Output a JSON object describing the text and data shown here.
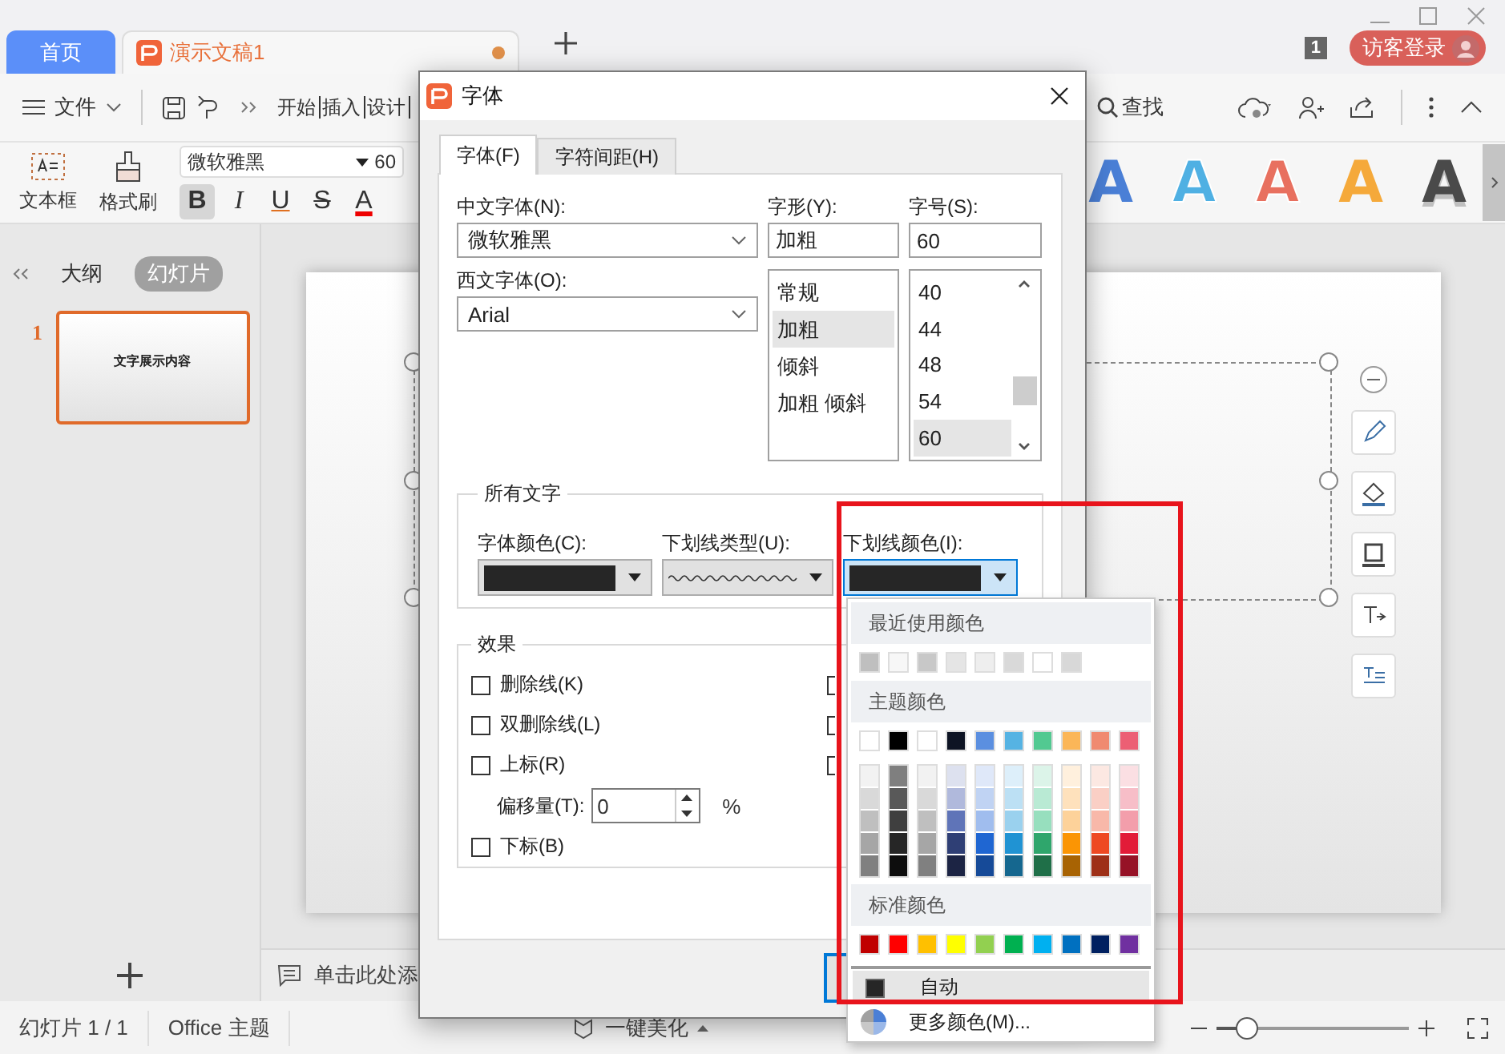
{
  "tabs": [
    {
      "kind": "home",
      "label": "首页"
    },
    {
      "kind": "document",
      "label": "演示文稿1",
      "unsaved": true
    }
  ],
  "window_count": "1",
  "login_button": "访客登录",
  "menu": {
    "file": "文件",
    "items": [
      "开始",
      "插入",
      "设计"
    ],
    "search": "查找"
  },
  "ribbon": {
    "textbox": "文本框",
    "format_painter": "格式刷",
    "font_name": "微软雅黑",
    "font_size": "60",
    "styles": [
      {
        "kind": "bold",
        "label": "B",
        "selected": true
      },
      {
        "kind": "italic",
        "label": "I",
        "selected": false
      },
      {
        "kind": "underline",
        "label": "U",
        "selected": false
      },
      {
        "kind": "strike",
        "label": "S",
        "selected": false
      },
      {
        "kind": "color",
        "label": "A",
        "selected": false
      }
    ],
    "wordart": [
      {
        "kind": "fill",
        "label": "A",
        "color": "#4a7fd6"
      },
      {
        "kind": "outline",
        "label": "A",
        "color": "#4fb0e3"
      },
      {
        "kind": "outline",
        "label": "A",
        "color": "#e8705f"
      },
      {
        "kind": "fill",
        "label": "A",
        "color": "#f5a93a"
      },
      {
        "kind": "gradient",
        "label": "A",
        "color": "#4a4a4a"
      }
    ]
  },
  "side_panel": {
    "tabs": [
      {
        "label": "大纲",
        "selected": false
      },
      {
        "label": "幻灯片",
        "selected": true
      }
    ],
    "slides": [
      {
        "number": "1",
        "title": "文字展示内容",
        "selected": true
      }
    ]
  },
  "notes_placeholder": "单击此处添",
  "status_bar": {
    "slide_count": "幻灯片 1 / 1",
    "theme": "Office 主题",
    "beautify": "一键美化",
    "zoom": {
      "level": 0.15
    }
  },
  "dialog": {
    "title": "字体",
    "tabs": [
      {
        "label": "字体(F)",
        "selected": true
      },
      {
        "label": "字符间距(H)",
        "selected": false
      }
    ],
    "chinese_font": {
      "label": "中文字体(N):",
      "value": "微软雅黑"
    },
    "western_font": {
      "label": "西文字体(O):",
      "value": "Arial"
    },
    "font_style": {
      "label": "字形(Y):",
      "value": "加粗",
      "options": [
        {
          "label": "常规",
          "selected": false
        },
        {
          "label": "加粗",
          "selected": true
        },
        {
          "label": "倾斜",
          "selected": false
        },
        {
          "label": "加粗 倾斜",
          "selected": false
        }
      ]
    },
    "font_size": {
      "label": "字号(S):",
      "value": "60",
      "options": [
        {
          "label": "40",
          "selected": false
        },
        {
          "label": "44",
          "selected": false
        },
        {
          "label": "48",
          "selected": false
        },
        {
          "label": "54",
          "selected": false
        },
        {
          "label": "60",
          "selected": true
        }
      ]
    },
    "all_text": {
      "title": "所有文字",
      "font_color": {
        "label": "字体颜色(C):",
        "color": "#262626",
        "focused": false
      },
      "underline_type": {
        "label": "下划线类型(U):",
        "kind": "wavy"
      },
      "underline_color": {
        "label": "下划线颜色(I):",
        "color": "#262626",
        "focused": true
      }
    },
    "effects": {
      "title": "效果",
      "options": [
        {
          "label": "删除线(K)",
          "checked": false
        },
        {
          "label": "双删除线(L)",
          "checked": false
        },
        {
          "label": "上标(R)",
          "checked": false
        },
        {
          "label": "下标(B)",
          "checked": false
        }
      ],
      "hidden_options": [
        {
          "checked": false
        },
        {
          "checked": false
        },
        {
          "checked": false
        }
      ],
      "offset": {
        "label": "偏移量(T):",
        "value": "0",
        "unit": "%"
      }
    }
  },
  "color_menu": {
    "recent_title": "最近使用颜色",
    "recent": [
      {
        "color": "#bfbfbf"
      },
      {
        "color": "#f7f7f7"
      },
      {
        "color": "#c8c8c8"
      },
      {
        "color": "#e5e5e5"
      },
      {
        "color": "#eeeeee"
      },
      {
        "color": "#d9d9d9"
      },
      {
        "color": "#ffffff"
      },
      {
        "color": "#d8d8d8"
      }
    ],
    "theme_title": "主题颜色",
    "theme": [
      {
        "color": "#ffffff"
      },
      {
        "color": "#000000"
      },
      {
        "color": "#ffffff"
      },
      {
        "color": "#0e1424"
      },
      {
        "color": "#5b8fe0"
      },
      {
        "color": "#56b3e3"
      },
      {
        "color": "#52c991"
      },
      {
        "color": "#fbb658"
      },
      {
        "color": "#f08a70"
      },
      {
        "color": "#ec5f74"
      }
    ],
    "shades": [
      [
        {
          "color": "#f2f2f2"
        },
        {
          "color": "#d9d9d9"
        },
        {
          "color": "#bfbfbf"
        },
        {
          "color": "#a6a6a6"
        },
        {
          "color": "#808080"
        }
      ],
      [
        {
          "color": "#7f7f7f"
        },
        {
          "color": "#595959"
        },
        {
          "color": "#3f3f3f"
        },
        {
          "color": "#262626"
        },
        {
          "color": "#0d0d0d"
        }
      ],
      [
        {
          "color": "#f2f2f2"
        },
        {
          "color": "#d9d9d9"
        },
        {
          "color": "#bfbfbf"
        },
        {
          "color": "#a6a6a6"
        },
        {
          "color": "#808080"
        }
      ],
      [
        {
          "color": "#dde1ef"
        },
        {
          "color": "#b0b9dc"
        },
        {
          "color": "#5f74b8"
        },
        {
          "color": "#2f3f75"
        },
        {
          "color": "#1c2444"
        }
      ],
      [
        {
          "color": "#dfe8f9"
        },
        {
          "color": "#c0d3f3"
        },
        {
          "color": "#a0bdee"
        },
        {
          "color": "#1f66d2"
        },
        {
          "color": "#164a98"
        }
      ],
      [
        {
          "color": "#ddeffa"
        },
        {
          "color": "#bce0f4"
        },
        {
          "color": "#9ad1ee"
        },
        {
          "color": "#2093d3"
        },
        {
          "color": "#15678f"
        }
      ],
      [
        {
          "color": "#dcf4e9"
        },
        {
          "color": "#b9ead4"
        },
        {
          "color": "#97dfbe"
        },
        {
          "color": "#2fa66c"
        },
        {
          "color": "#1f6f48"
        }
      ],
      [
        {
          "color": "#fff0dd"
        },
        {
          "color": "#fee1bc"
        },
        {
          "color": "#fdd29a"
        },
        {
          "color": "#fb9504"
        },
        {
          "color": "#a86303"
        }
      ],
      [
        {
          "color": "#fce8e2"
        },
        {
          "color": "#facfc5"
        },
        {
          "color": "#f8b8a9"
        },
        {
          "color": "#ee4922"
        },
        {
          "color": "#9e3018"
        }
      ],
      [
        {
          "color": "#fbdfe3"
        },
        {
          "color": "#f7bec8"
        },
        {
          "color": "#f39eab"
        },
        {
          "color": "#e21b38"
        },
        {
          "color": "#961226"
        }
      ]
    ],
    "standard_title": "标准颜色",
    "standard": [
      {
        "color": "#c00000"
      },
      {
        "color": "#ff0000"
      },
      {
        "color": "#ffc000"
      },
      {
        "color": "#ffff00"
      },
      {
        "color": "#92d050"
      },
      {
        "color": "#00b050"
      },
      {
        "color": "#00b0f0"
      },
      {
        "color": "#0070c0"
      },
      {
        "color": "#002060"
      },
      {
        "color": "#7030a0"
      }
    ],
    "auto": {
      "label": "自动",
      "color": "#262626",
      "selected": true
    },
    "more": "更多颜色(M)..."
  }
}
